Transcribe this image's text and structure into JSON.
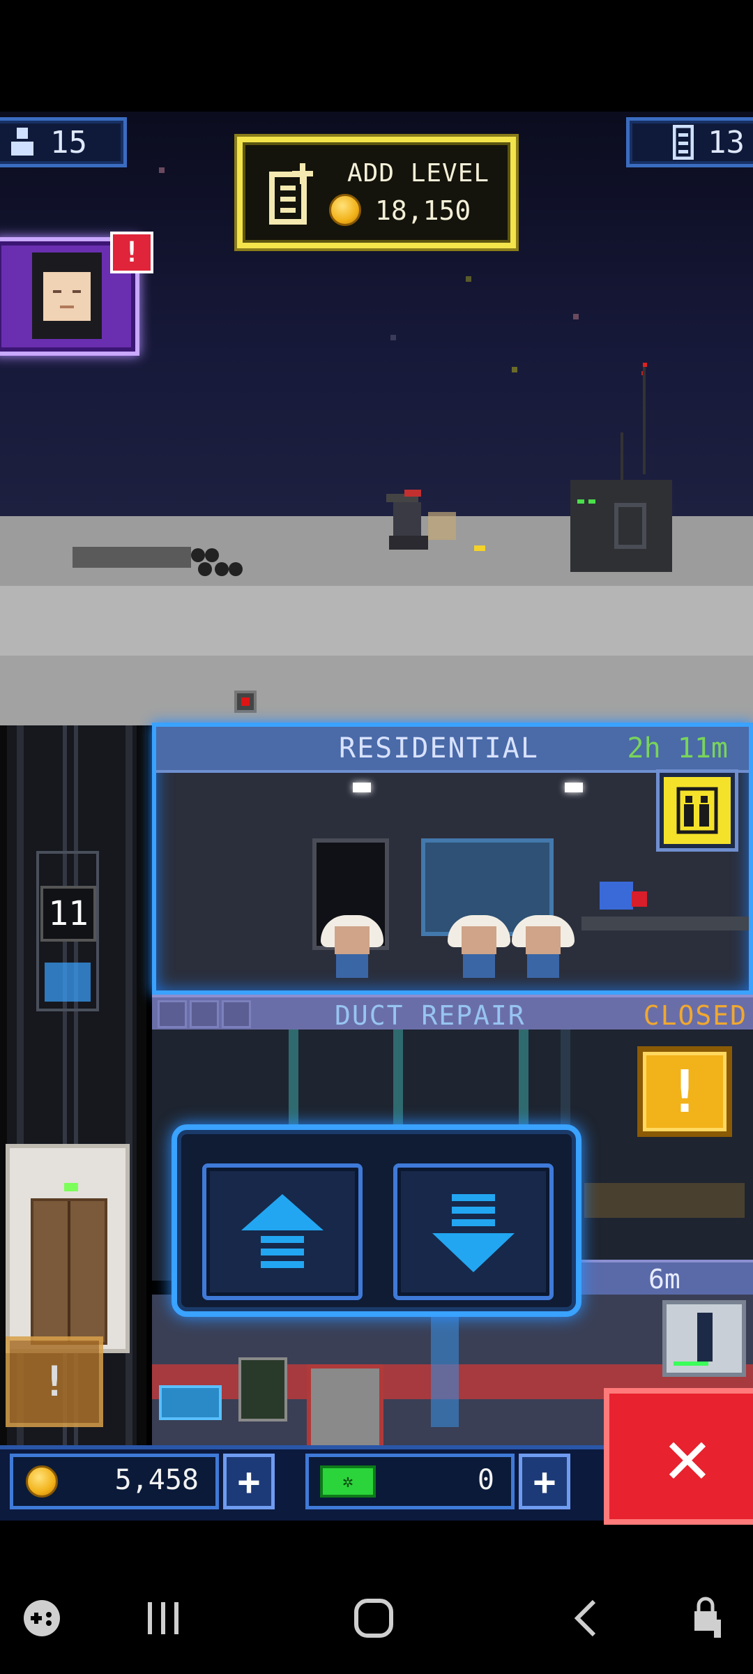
{
  "hud": {
    "population": "15",
    "levels": "13"
  },
  "add_level": {
    "label": "ADD LEVEL",
    "cost": "18,150"
  },
  "avatar_alert": "!",
  "residential": {
    "name": "RESIDENTIAL",
    "timer": "2h 11m"
  },
  "duct_repair": {
    "name": "DUCT REPAIR",
    "status": "CLOSED"
  },
  "floor_indicator": "11",
  "alert_mark": "!",
  "floor3_timer": "6m",
  "currency": {
    "coins": "5,458",
    "bux": "0",
    "plus": "+"
  },
  "close_symbol": "✕",
  "icons": {
    "population": "person-icon",
    "levels": "building-icon",
    "add_level": "add-level-icon",
    "coin": "coin-icon",
    "bux": "bux-icon",
    "up": "up-arrow-icon",
    "down": "down-arrow-icon",
    "move": "move-tenant-icon"
  },
  "colors": {
    "accent_blue": "#3aa2ff",
    "gold": "#f4e44c",
    "alert_red": "#e0243a",
    "alert_orange": "#f2b21a",
    "closed_text": "#f0a830",
    "timer_green": "#79d45a"
  }
}
